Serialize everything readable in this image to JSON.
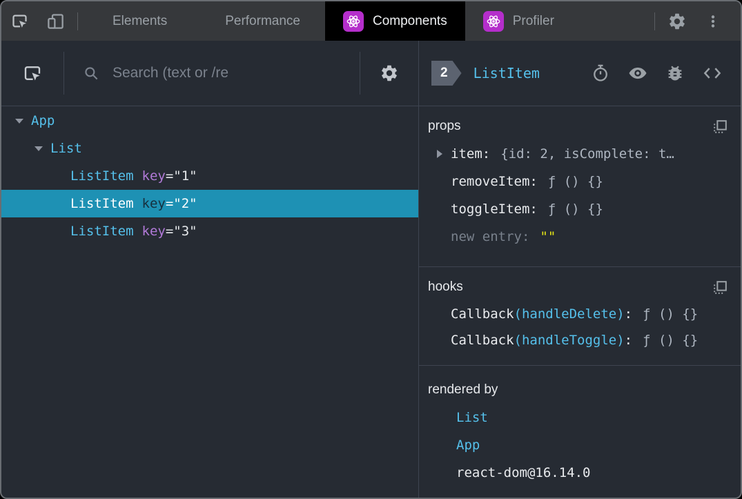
{
  "topbar": {
    "tabs": [
      {
        "label": "Elements"
      },
      {
        "label": "Performance"
      },
      {
        "label": "Components"
      },
      {
        "label": "Profiler"
      }
    ]
  },
  "left": {
    "search_placeholder": "Search (text or /re",
    "tree": {
      "rows": [
        {
          "name": "App"
        },
        {
          "name": "List"
        },
        {
          "name": "ListItem",
          "attr": "key",
          "value": "=\"1\""
        },
        {
          "name": "ListItem",
          "attr": "key",
          "value": "=\"2\""
        },
        {
          "name": "ListItem",
          "attr": "key",
          "value": "=\"3\""
        }
      ]
    }
  },
  "right": {
    "badge_count": "2",
    "component_name": "ListItem",
    "props": {
      "heading": "props",
      "rows": [
        {
          "name": "item:",
          "value": "{id: 2, isComplete: t…"
        },
        {
          "name": "removeItem:",
          "value": "ƒ () {}"
        },
        {
          "name": "toggleItem:",
          "value": "ƒ () {}"
        },
        {
          "name": "new entry:",
          "value": "\"\""
        }
      ]
    },
    "hooks": {
      "heading": "hooks",
      "rows": [
        {
          "fn": "Callback",
          "arg": "(handleDelete)",
          "sep": ":",
          "value": "ƒ () {}"
        },
        {
          "fn": "Callback",
          "arg": "(handleToggle)",
          "sep": ":",
          "value": "ƒ () {}"
        }
      ]
    },
    "rendered_by": {
      "heading": "rendered by",
      "items": [
        "List",
        "App",
        "react-dom@16.14.0"
      ]
    }
  },
  "colors": {
    "accent_cyan": "#55c0eb",
    "attr_purple": "#b17ad8",
    "selection_teal": "#1e91b4",
    "react_purple": "#b52ecb",
    "editable_yellow": "#e6e616",
    "panel_bg": "#262b33",
    "chrome_bg": "#36383b"
  }
}
